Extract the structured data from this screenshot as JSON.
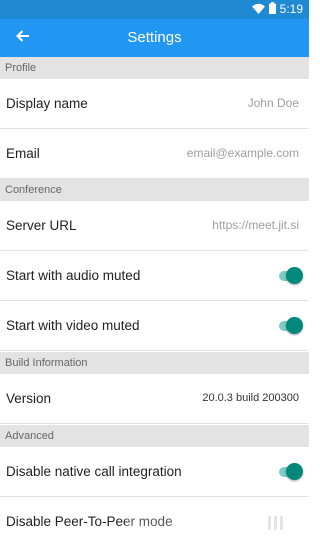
{
  "status_bar": {
    "time": "5:19"
  },
  "app_bar": {
    "title": "Settings"
  },
  "sections": {
    "profile": "Profile",
    "conference": "Conference",
    "build_information": "Build Information",
    "advanced": "Advanced"
  },
  "profile": {
    "display_name": {
      "label": "Display name",
      "placeholder": "John Doe"
    },
    "email": {
      "label": "Email",
      "placeholder": "email@example.com"
    }
  },
  "conference": {
    "server_url": {
      "label": "Server URL",
      "placeholder": "https://meet.jit.si"
    },
    "audio_muted": {
      "label": "Start with audio muted",
      "enabled": true
    },
    "video_muted": {
      "label": "Start with video muted",
      "enabled": true
    }
  },
  "build": {
    "version": {
      "label": "Version",
      "value": "20.0.3 build 200300"
    }
  },
  "advanced": {
    "native_call": {
      "label": "Disable native call integration",
      "enabled": true
    },
    "p2p": {
      "label": "Disable Peer-To-Peer mode",
      "enabled": false
    }
  },
  "colors": {
    "app_bar": "#2196f3",
    "status_bar": "#1f8ad3",
    "toggle_on": "#00897b",
    "toggle_track": "#80cbc4"
  }
}
